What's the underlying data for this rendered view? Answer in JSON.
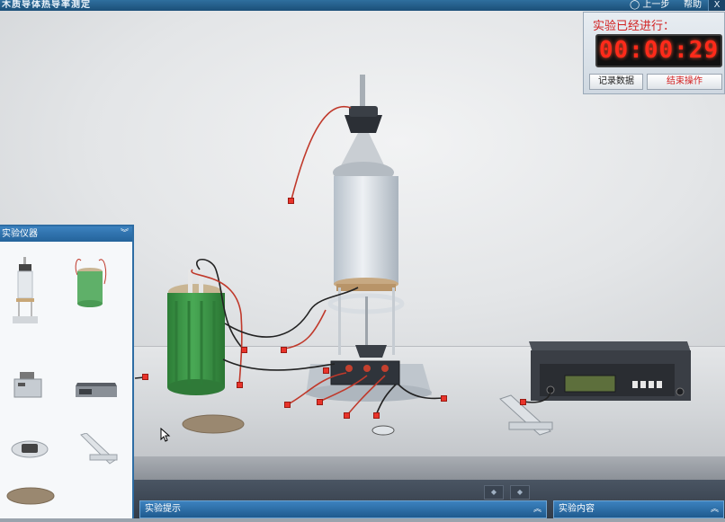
{
  "window": {
    "title": "木质导体热导率测定",
    "menu_items": [
      "上一步",
      "帮助"
    ],
    "close_label": "X"
  },
  "timer": {
    "label": "实验已经进行：",
    "time": "00:00:29",
    "record_button": "记录数据",
    "end_button": "结束操作"
  },
  "instrument_panel": {
    "title": "实验仪器",
    "collapse_icon": "double-chevron-down-icon",
    "items": [
      {
        "name": "thermal-conductivity-apparatus-icon"
      },
      {
        "name": "green-heater-icon"
      },
      {
        "name": "water-bath-icon"
      },
      {
        "name": "meter-box-icon"
      },
      {
        "name": "sample-tray-icon"
      },
      {
        "name": "caliper-icon"
      },
      {
        "name": "sample-disc-icon"
      }
    ]
  },
  "bottom_tabs": [
    {
      "label": "实验提示",
      "icon": "double-chevron-up-icon"
    },
    {
      "label": "实验内容",
      "icon": "double-chevron-up-icon"
    }
  ],
  "colors": {
    "accent": "#2e6da4",
    "timer_digits": "#ff2a1a",
    "marker": "#e8332a",
    "heater_green": "#3f9a4a"
  }
}
